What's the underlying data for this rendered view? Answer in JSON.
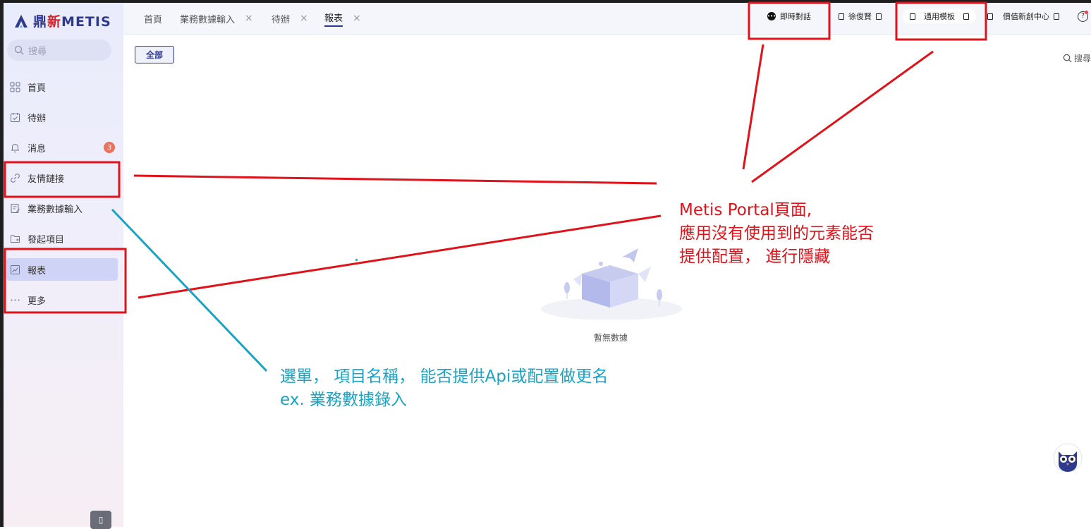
{
  "logo": {
    "brand_cn_a": "鼎",
    "brand_cn_b": "新",
    "brand_en": "METIS"
  },
  "sidebar": {
    "search_placeholder": "搜尋",
    "items": [
      {
        "label": "首頁",
        "icon": "grid-icon"
      },
      {
        "label": "待辦",
        "icon": "calendar-check-icon"
      },
      {
        "label": "消息",
        "icon": "bell-icon",
        "badge": "3"
      },
      {
        "label": "友情鏈接",
        "icon": "link-icon"
      },
      {
        "label": "業務數據輸入",
        "icon": "edit-doc-icon"
      },
      {
        "label": "發起項目",
        "icon": "folder-icon"
      },
      {
        "label": "報表",
        "icon": "chart-icon",
        "active": true
      },
      {
        "label": "更多",
        "icon": "more-dots-icon"
      }
    ],
    "collapse_glyph": "▯"
  },
  "tabs": [
    {
      "label": "首頁",
      "closable": false
    },
    {
      "label": "業務數據輸入",
      "closable": true
    },
    {
      "label": "待辦",
      "closable": true
    },
    {
      "label": "報表",
      "closable": true,
      "active": true
    }
  ],
  "tab_close_glyph": "×",
  "header": {
    "chat_label": "即時對話",
    "user_name": "徐俊賢",
    "template_label": "通用模板",
    "center_label": "價值新創中心",
    "help_glyph": "?"
  },
  "content": {
    "filter_all": "全部",
    "search_label": "搜尋",
    "empty_text": "暫無數據"
  },
  "annotations": {
    "red_note": [
      "Metis Portal頁面,",
      "應用沒有使用到的元素能否",
      "提供配置， 進行隱藏"
    ],
    "blue_note": [
      "選單， 項目名稱， 能否提供Api或配置做更名",
      "ex. 業務數據錄入"
    ]
  },
  "colors": {
    "annotation_red": "#e0121a",
    "annotation_blue": "#1aa3c4",
    "brand": "#2f3a8f"
  }
}
